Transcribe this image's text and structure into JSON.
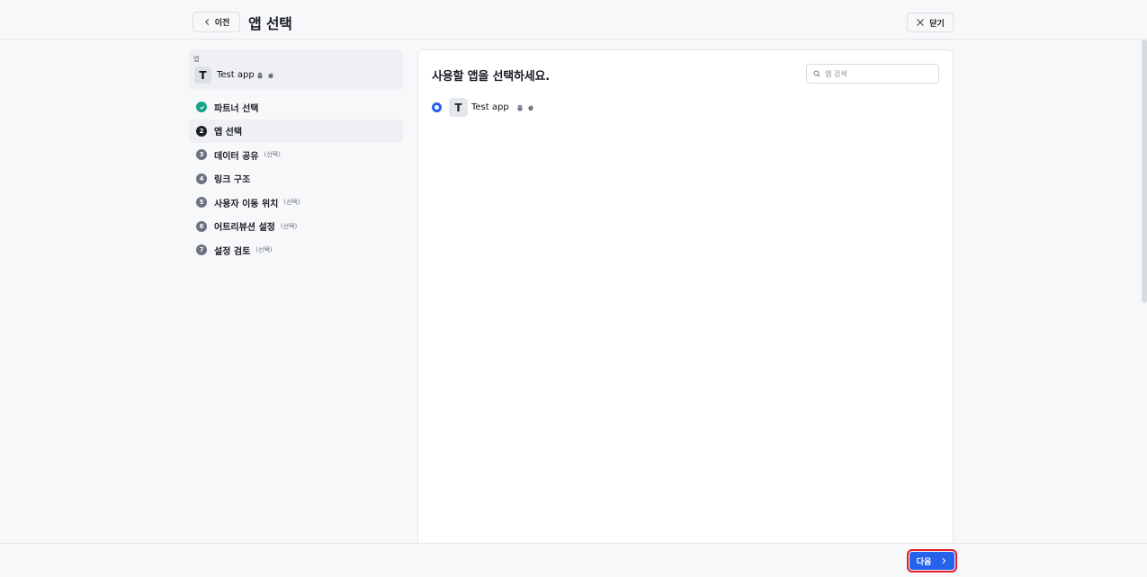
{
  "header": {
    "back_label": "이전",
    "title": "앱 선택",
    "close_label": "닫기"
  },
  "sidebar": {
    "app_section_label": "앱",
    "app": {
      "avatar_letter": "T",
      "name": "Test app",
      "platforms": [
        "android-icon",
        "apple-icon"
      ]
    },
    "steps": [
      {
        "number": "✓",
        "label": "파트너 선택",
        "optional": "",
        "state": "done"
      },
      {
        "number": "2",
        "label": "앱 선택",
        "optional": "",
        "state": "active"
      },
      {
        "number": "3",
        "label": "데이터 공유",
        "optional": "(선택)",
        "state": "pending"
      },
      {
        "number": "4",
        "label": "링크 구조",
        "optional": "",
        "state": "pending"
      },
      {
        "number": "5",
        "label": "사용자 이동 위치",
        "optional": "(선택)",
        "state": "pending"
      },
      {
        "number": "6",
        "label": "어트리뷰션 설정",
        "optional": "(선택)",
        "state": "pending"
      },
      {
        "number": "7",
        "label": "설정 검토",
        "optional": "(선택)",
        "state": "pending"
      }
    ]
  },
  "main": {
    "title": "사용할 앱을 선택하세요.",
    "search": {
      "placeholder": "앱 검색",
      "value": ""
    },
    "apps": [
      {
        "avatar_letter": "T",
        "name": "Test app",
        "selected": true,
        "platforms": [
          "android-icon",
          "apple-icon"
        ]
      }
    ]
  },
  "footer": {
    "next_label": "다음"
  },
  "colors": {
    "accent": "#2563eb",
    "done": "#16a085",
    "highlight_outline": "#e11d2a"
  }
}
